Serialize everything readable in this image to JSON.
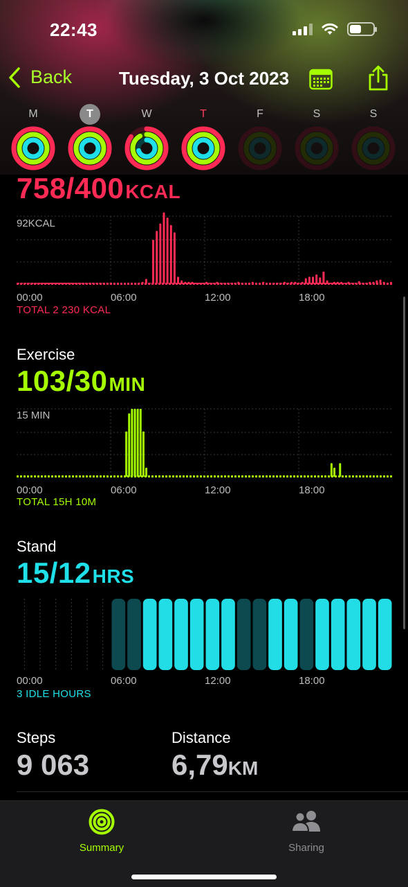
{
  "status_bar": {
    "time": "22:43"
  },
  "nav": {
    "back_label": "Back",
    "date_title": "Tuesday, 3 Oct 2023"
  },
  "week": {
    "days": [
      "M",
      "T",
      "W",
      "T",
      "F",
      "S",
      "S"
    ],
    "selected_index": 1,
    "today_index": 3
  },
  "move": {
    "value": "758/400",
    "unit": "KCAL",
    "color": "#ff2b55",
    "max_label": "92KCAL",
    "x_ticks": [
      "00:00",
      "06:00",
      "12:00",
      "18:00"
    ],
    "total": "TOTAL 2 230 KCAL",
    "chart_data": {
      "type": "bar",
      "x_start_time": "00:00",
      "x_end_time": "24:00",
      "x_unit": "minutes since 00:00",
      "bar_interval_minutes": 15,
      "ylim": [
        0,
        92
      ],
      "y_unit": "KCAL",
      "values": [
        2,
        2,
        2,
        2,
        2,
        2,
        2,
        2,
        2,
        2,
        2,
        2,
        2,
        2,
        2,
        2,
        2,
        2,
        2,
        2,
        2,
        2,
        2,
        2,
        2,
        2,
        2,
        2,
        2,
        2,
        2,
        2,
        2,
        2,
        2,
        3,
        7,
        2,
        60,
        72,
        82,
        97,
        90,
        80,
        70,
        10,
        5,
        3,
        3,
        3,
        2,
        2,
        2,
        3,
        2,
        2,
        3,
        2,
        2,
        2,
        2,
        2,
        3,
        2,
        2,
        2,
        3,
        2,
        2,
        3,
        2,
        2,
        2,
        2,
        2,
        3,
        2,
        3,
        3,
        2,
        3,
        8,
        10,
        10,
        13,
        9,
        17,
        5,
        2,
        3,
        3,
        3,
        2,
        3,
        2,
        2,
        4,
        2,
        2,
        3,
        3,
        5,
        6,
        3,
        2,
        3
      ]
    }
  },
  "exercise": {
    "label": "Exercise",
    "value": "103/30",
    "unit": "MIN",
    "color": "#a6ff00",
    "max_label": "15 MIN",
    "x_ticks": [
      "00:00",
      "06:00",
      "12:00",
      "18:00"
    ],
    "total": "TOTAL 15H 10M",
    "chart_data": {
      "type": "bar",
      "x_start_time": "00:00",
      "x_end_time": "24:00",
      "x_unit": "minutes since 00:00",
      "bar_interval_minutes": 15,
      "ylim": [
        0,
        15
      ],
      "y_unit": "MIN",
      "values": [
        0,
        0,
        0,
        0,
        0,
        0,
        0,
        0,
        0,
        0,
        0,
        0,
        0,
        0,
        0,
        0,
        0,
        0,
        0,
        0,
        0,
        0,
        0,
        0,
        0,
        0,
        0,
        0,
        0,
        0,
        0,
        0,
        0,
        0,
        0,
        0,
        0,
        0,
        10,
        14,
        15,
        15,
        15,
        15,
        10,
        2,
        0,
        0,
        0,
        0,
        0,
        0,
        0,
        0,
        0,
        0,
        0,
        0,
        0,
        0,
        0,
        0,
        0,
        0,
        0,
        0,
        0,
        0,
        0,
        0,
        0,
        0,
        0,
        0,
        0,
        0,
        0,
        0,
        0,
        0,
        0,
        0,
        0,
        0,
        0,
        0,
        0,
        0,
        0,
        0,
        0,
        0,
        0,
        0,
        0,
        0,
        0,
        0,
        0,
        0,
        0,
        0,
        0,
        0,
        0,
        0,
        0,
        0,
        0,
        0,
        3,
        2,
        0,
        3,
        0,
        0,
        0,
        0,
        0,
        0,
        0,
        0,
        0,
        0,
        0,
        0,
        0,
        0,
        0,
        0,
        0,
        0
      ]
    }
  },
  "stand": {
    "label": "Stand",
    "value": "15/12",
    "unit": "HRS",
    "color": "#1fe0e8",
    "x_ticks": [
      "00:00",
      "06:00",
      "12:00",
      "18:00"
    ],
    "idle": "3 IDLE HOURS",
    "chart_data": {
      "type": "bar",
      "x_unit": "hour of day",
      "categories": [
        "0",
        "1",
        "2",
        "3",
        "4",
        "5",
        "6",
        "7",
        "8",
        "9",
        "10",
        "11",
        "12",
        "13",
        "14",
        "15",
        "16",
        "17",
        "18",
        "19",
        "20",
        "21",
        "22",
        "23"
      ],
      "values": [
        0,
        0,
        0,
        0,
        0,
        0,
        0,
        0,
        1,
        1,
        1,
        1,
        1,
        1,
        0,
        0,
        1,
        1,
        0,
        1,
        1,
        1,
        1,
        1
      ],
      "active_hours": [
        6,
        7,
        8,
        9,
        10,
        11,
        12,
        13,
        16,
        17,
        19,
        20,
        21,
        22,
        23
      ],
      "idle_hours": [
        14,
        15,
        18
      ]
    }
  },
  "steps": {
    "label": "Steps",
    "value": "9 063"
  },
  "distance": {
    "label": "Distance",
    "value": "6,79",
    "unit": "KM"
  },
  "tabs": [
    {
      "label": "Summary",
      "active": true
    },
    {
      "label": "Sharing",
      "active": false
    }
  ],
  "colors": {
    "accent": "#a6ff00",
    "move": "#ff2b55",
    "exercise": "#a6ff00",
    "stand": "#1fe0e8",
    "tab_inactive": "#8e8e93"
  }
}
